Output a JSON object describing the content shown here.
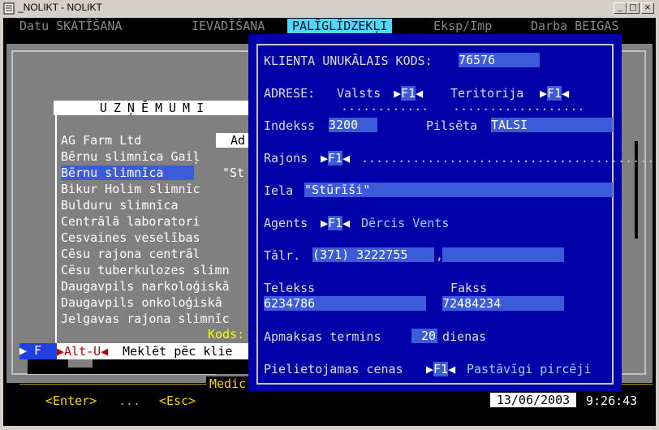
{
  "window": {
    "title": "_NOLIKT - NOLIKT",
    "min": "_",
    "max": "□",
    "close": "×"
  },
  "menu": [
    {
      "hk": "",
      "pre": "Datu ",
      "key": "S",
      "post": "KATĪŠANA",
      "text": "Datu SKATĪŠANA"
    },
    {
      "key": "I",
      "post": "EVADĪŠANA",
      "text": "IEVADĪŠANA"
    },
    {
      "key": "P",
      "post": "ALĪGLĪDZEKĻI",
      "text": "PALĪGLĪDZEKĻI"
    },
    {
      "key": "E",
      "post": "ksp/Imp",
      "text": "Eksp/Imp"
    },
    {
      "pre": "Darba ",
      "key": "B",
      "post": "EIGAS",
      "text": "Darba BEIGAS"
    }
  ],
  "list": {
    "title": "UZŅĒMUMI",
    "items": [
      "AG Farm Ltd",
      "Bērnu slimnīca Gaiļ",
      "Bērnu slimnīca",
      "Bikur Holim slimnīc",
      "Bulduru slimnīca",
      "Centrālā laboratori",
      "Cesvaines veselības",
      "Cēsu rajona centrāl",
      "Cēsu tuberkulozes slimn",
      "Daugavpils narkoloģiskā",
      "Daugavpils onkoloģiskā",
      "Jelgavas rajona slimnīc"
    ],
    "selected_index": 2,
    "panel_label": "Ad",
    "panel_value": "\"St",
    "kods_label": "Kods:"
  },
  "status": {
    "f_label": "▶ F",
    "alt_u": "▶Alt-U◀",
    "search_text": " Meklēt pēc klie"
  },
  "footer": {
    "medic": "Medic",
    "enter": "<Enter>",
    "dots": "...",
    "esc": "<Esc>",
    "date": "13/06/2003",
    "time": "9:26:43"
  },
  "dialog": {
    "code_label": "KLIENTA UNUKĀLAIS KODS:",
    "code_value": "76576",
    "address_label": "ADRESE:",
    "country_label": "Valsts",
    "territory_label": "Teritorija",
    "f1": "F1",
    "index_label": "Indekss",
    "index_value": "3200",
    "city_label": "Pilsēta",
    "city_value": "TALSI",
    "district_label": "Rajons",
    "street_label": "Iela",
    "street_value": "\"Stūrīši\"",
    "agent_label": "Agents",
    "agent_value": "Dērcis Vents",
    "phone_label": "Tālr.",
    "phone_value": "(371) 3222755",
    "phone_sep": ",",
    "phone2_value": "",
    "telex_label": "Telekss",
    "telex_value": "6234786",
    "fax_label": "Fakss",
    "fax_value": "72484234",
    "payment_label": "Apmaksas termins",
    "payment_value": "20",
    "payment_unit": "dienas",
    "prices_label": "Pielietojamas cenas",
    "prices_value": "Pastāvīgi pircēji"
  }
}
